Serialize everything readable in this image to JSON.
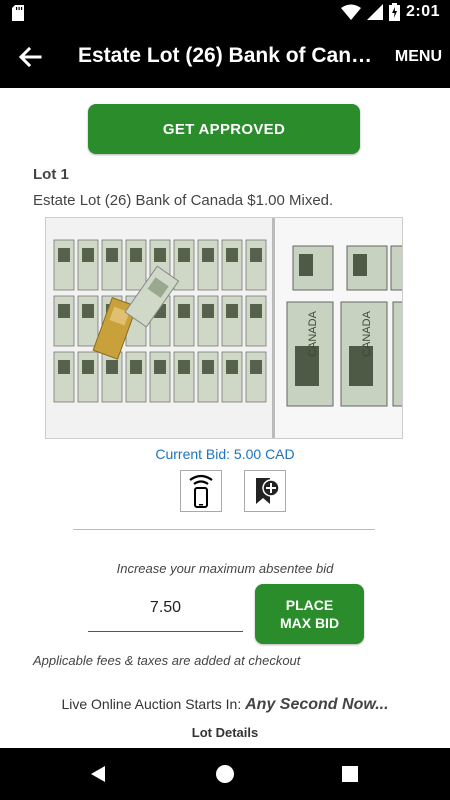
{
  "status_bar": {
    "time": "2:01"
  },
  "app_bar": {
    "title": "Estate Lot (26) Bank of Cana…",
    "menu_label": "MENU"
  },
  "main": {
    "approve_label": "GET APPROVED",
    "lot_number": "Lot 1",
    "lot_description": "Estate Lot (26) Bank of Canada $1.00 Mixed.",
    "current_bid": "Current Bid: 5.00 CAD",
    "increase_label": "Increase your maximum absentee bid",
    "bid_value": "7.50",
    "place_bid_line1": "PLACE",
    "place_bid_line2": "MAX BID",
    "fees_note": "Applicable fees & taxes are added at checkout",
    "live_prefix": "Live Online Auction Starts In:",
    "live_status": "Any Second Now...",
    "lot_details": "Lot Details",
    "banknote_text": "CANADA"
  },
  "colors": {
    "accent_green": "#2a8c2a",
    "link_blue": "#1e73be",
    "bar": "#000000"
  },
  "icons": [
    "sd-card-icon",
    "wifi-icon",
    "signal-icon",
    "battery-icon",
    "back-arrow-icon",
    "phone-signal-icon",
    "bookmark-add-icon",
    "nav-back-icon",
    "nav-home-icon",
    "nav-recent-icon"
  ]
}
